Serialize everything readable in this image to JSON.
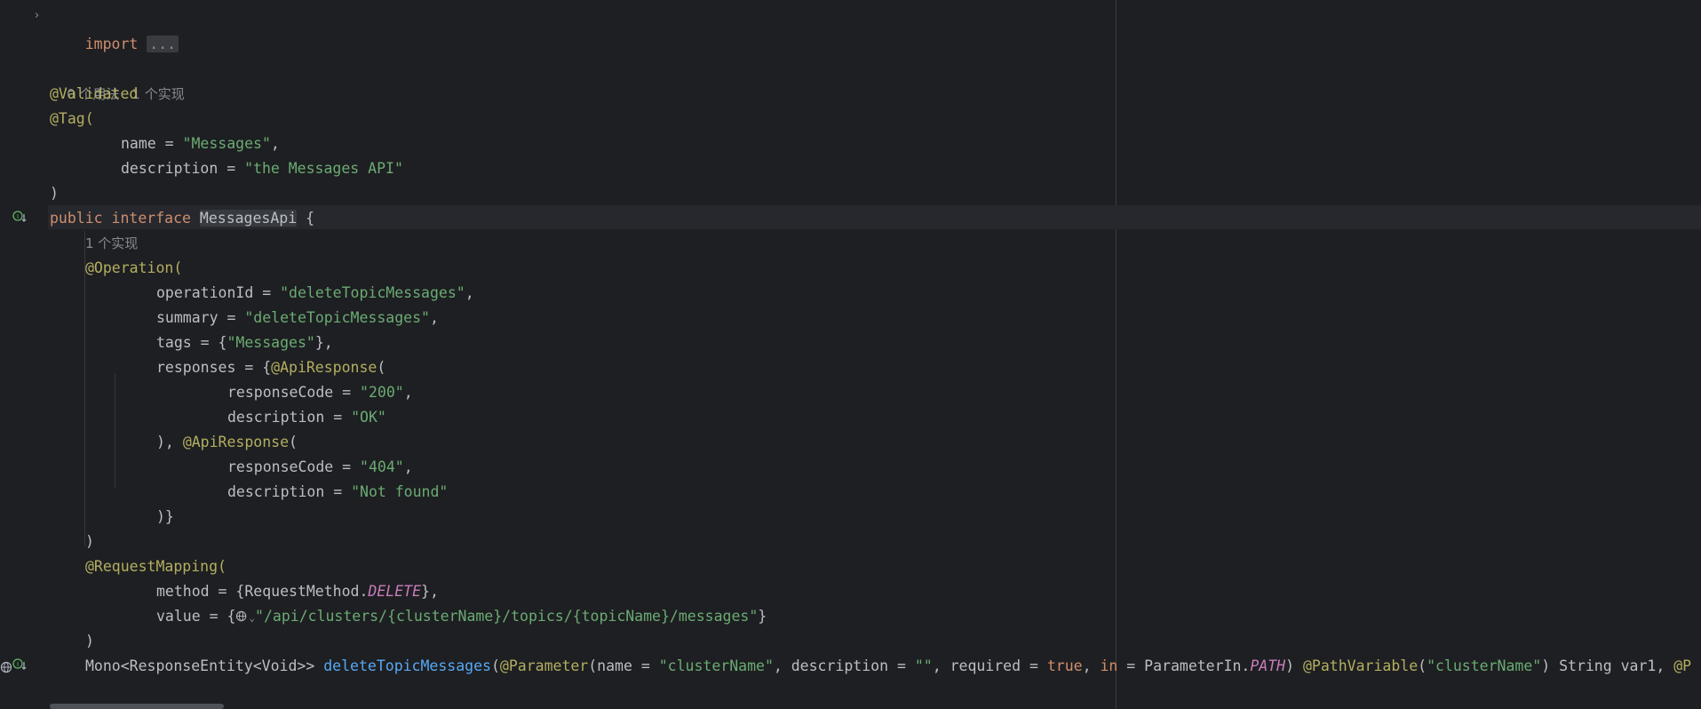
{
  "editor": {
    "lines": {
      "import_kw": "import",
      "import_fold": "...",
      "hint_top_usages": "0 个用法",
      "hint_top_impl": "1 个实现",
      "validated": "@Validated",
      "tag_open": "@Tag(",
      "tag_name_key": "name = ",
      "tag_name_val": "\"Messages\"",
      "tag_name_end": ",",
      "tag_desc_key": "description = ",
      "tag_desc_val": "\"the Messages API\"",
      "tag_close": ")",
      "public_kw": "public",
      "interface_kw": "interface",
      "class_name": "MessagesApi",
      "brace_open": " {",
      "hint_method_impl": "1 个实现",
      "operation_open": "@Operation(",
      "op_id_key": "operationId = ",
      "op_id_val": "\"deleteTopicMessages\"",
      "op_id_end": ",",
      "summary_key": "summary = ",
      "summary_val": "\"deleteTopicMessages\"",
      "summary_end": ",",
      "tags_key": "tags = {",
      "tags_val": "\"Messages\"",
      "tags_end": "},",
      "responses_key": "responses = {",
      "api_response_1": "@ApiResponse",
      "paren_open_1": "(",
      "rc1_key": "responseCode = ",
      "rc1_val": "\"200\"",
      "rc1_end": ",",
      "d1_key": "description = ",
      "d1_val": "\"OK\"",
      "resp_sep": "), ",
      "api_response_2": "@ApiResponse",
      "paren_open_2": "(",
      "rc2_key": "responseCode = ",
      "rc2_val": "\"404\"",
      "rc2_end": ",",
      "d2_key": "description = ",
      "d2_val": "\"Not found\"",
      "responses_close": ")}",
      "operation_close": ")",
      "request_mapping_open": "@RequestMapping(",
      "method_key": "method = {RequestMethod.",
      "method_const": "DELETE",
      "method_end": "},",
      "value_key": "value = {",
      "value_val": "\"/api/clusters/{clusterName}/topics/{topicName}/messages\"",
      "value_end": "}",
      "request_mapping_close": ")",
      "sig_return": "Mono<ResponseEntity<Void>> ",
      "sig_method": "deleteTopicMessages",
      "sig_p1": "(",
      "sig_param_ann": "@Parameter",
      "sig_p2": "(name = ",
      "sig_name_val": "\"clusterName\"",
      "sig_p3": ", description = ",
      "sig_desc_val": "\"\"",
      "sig_p4": ", required = ",
      "sig_true": "true",
      "sig_p5": ", ",
      "sig_in": "in",
      "sig_p6": " = ParameterIn.",
      "sig_path": "PATH",
      "sig_p7": ") ",
      "sig_pathvar": "@PathVariable",
      "sig_p8": "(",
      "sig_pv_val": "\"clusterName\"",
      "sig_p9": ") String var1, ",
      "sig_trunc": "@P"
    }
  },
  "colors": {
    "background": "#1e1f22",
    "keyword": "#cf8e6d",
    "annotation": "#b3ae60",
    "string": "#6aab73",
    "method": "#56a8f5",
    "constant": "#c77dbb",
    "default_text": "#bcbec4",
    "hint": "#868a91"
  },
  "icons": {
    "fold": "chevron-right-icon",
    "interface_impl": "implemented-down-icon",
    "web_endpoint": "globe-icon"
  }
}
